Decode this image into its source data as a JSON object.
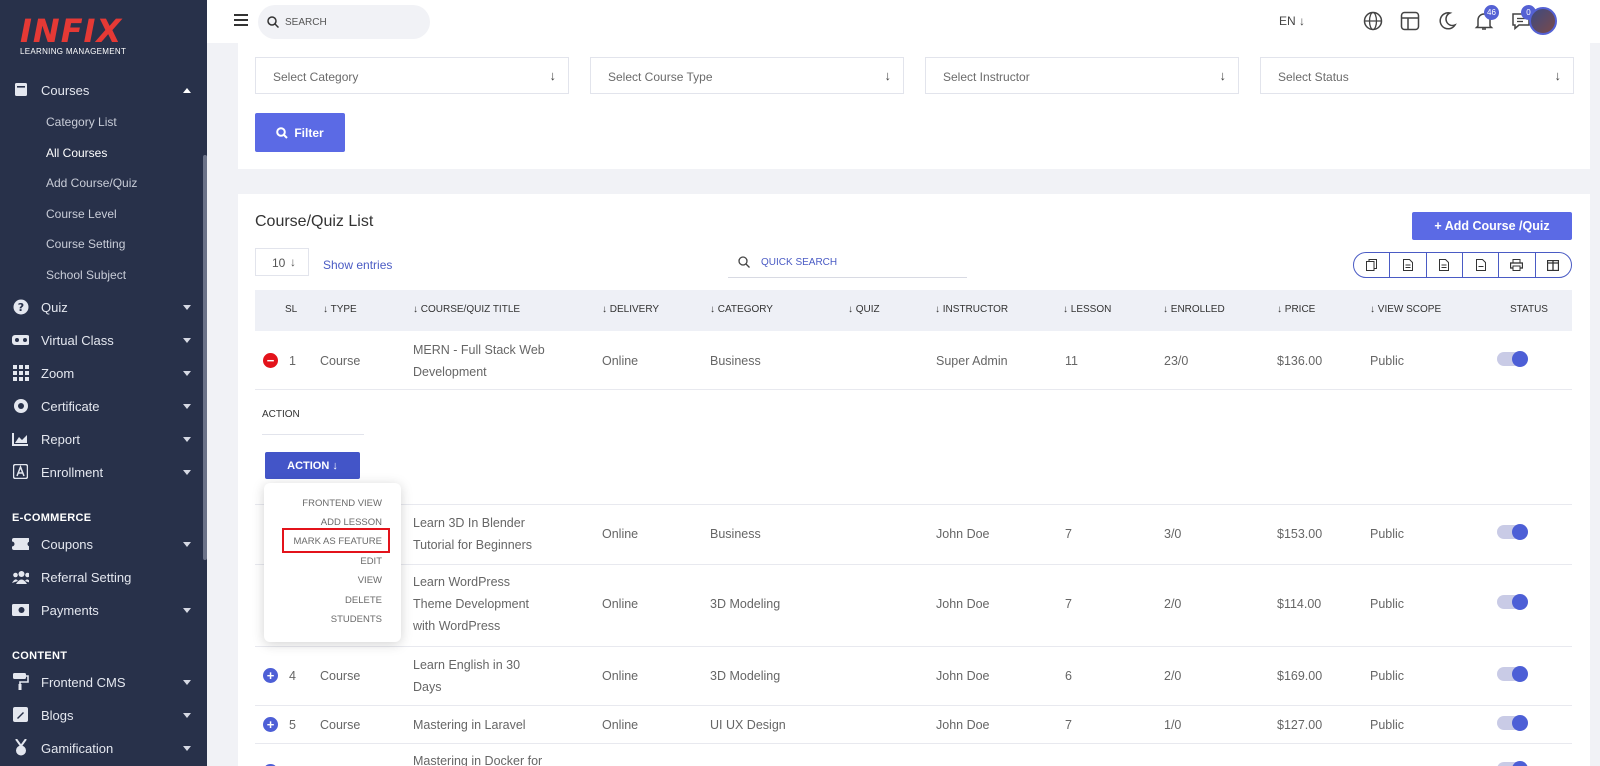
{
  "brand": {
    "logo": "INFIX",
    "tagline": "LEARNING MANAGEMENT"
  },
  "sidebar": {
    "courses": {
      "label": "Courses",
      "icon": "book-icon"
    },
    "sub_items": [
      "Category List",
      "All Courses",
      "Add Course/Quiz",
      "Course Level",
      "Course Setting",
      "School Subject"
    ],
    "items": [
      {
        "label": "Quiz",
        "icon": "question-icon"
      },
      {
        "label": "Virtual Class",
        "icon": "vr-icon"
      },
      {
        "label": "Zoom",
        "icon": "grid-icon"
      },
      {
        "label": "Certificate",
        "icon": "badge-icon"
      },
      {
        "label": "Report",
        "icon": "chart-icon"
      },
      {
        "label": "Enrollment",
        "icon": "enrollment-icon"
      }
    ],
    "section_ecommerce": "E-COMMERCE",
    "ecommerce_items": [
      {
        "label": "Coupons",
        "icon": "coupon-icon"
      },
      {
        "label": "Referral Setting",
        "icon": "users-icon"
      },
      {
        "label": "Payments",
        "icon": "money-icon"
      }
    ],
    "section_content": "CONTENT",
    "content_items": [
      {
        "label": "Frontend CMS",
        "icon": "paint-roller-icon"
      },
      {
        "label": "Blogs",
        "icon": "pen-icon"
      },
      {
        "label": "Gamification",
        "icon": "medal-icon"
      }
    ]
  },
  "topbar": {
    "search_placeholder": "SEARCH",
    "language": "EN ↓",
    "notifications": "46",
    "messages": "0"
  },
  "filters": {
    "category": "Select Category",
    "course_type": "Select Course Type",
    "instructor": "Select Instructor",
    "status": "Select Status",
    "filter_button": "Filter"
  },
  "list": {
    "title": "Course/Quiz List",
    "add_button": "+ Add Course /Quiz",
    "entries": "10",
    "show_entries": "Show entries",
    "quick_search": "QUICK SEARCH"
  },
  "table": {
    "headers": [
      "SL",
      "↓ TYPE",
      "↓ COURSE/QUIZ TITLE",
      "↓ DELIVERY",
      "↓ CATEGORY",
      "↓ QUIZ",
      "↓ INSTRUCTOR",
      "↓ LESSON",
      "↓ ENROLLED",
      "↓ PRICE",
      "↓ VIEW SCOPE",
      "STATUS"
    ],
    "rows": [
      {
        "sl": "1",
        "type": "Course",
        "title1": "MERN - Full Stack Web",
        "title2": "Development",
        "title3": "",
        "delivery": "Online",
        "category": "Business",
        "instructor": "Super Admin",
        "lesson": "11",
        "enrolled": "23/0",
        "price": "$136.00",
        "scope": "Public"
      },
      {
        "sl": "",
        "type": "",
        "title1": "Learn 3D In Blender",
        "title2": "Tutorial for Beginners",
        "title3": "",
        "delivery": "Online",
        "category": "Business",
        "instructor": "John Doe",
        "lesson": "7",
        "enrolled": "3/0",
        "price": "$153.00",
        "scope": "Public"
      },
      {
        "sl": "",
        "type": "",
        "title1": "Learn WordPress",
        "title2": "Theme Development",
        "title3": "with WordPress",
        "delivery": "Online",
        "category": "3D Modeling",
        "instructor": "John Doe",
        "lesson": "7",
        "enrolled": "2/0",
        "price": "$114.00",
        "scope": "Public"
      },
      {
        "sl": "4",
        "type": "Course",
        "title1": "Learn English in 30",
        "title2": "Days",
        "title3": "",
        "delivery": "Online",
        "category": "3D Modeling",
        "instructor": "John Doe",
        "lesson": "6",
        "enrolled": "2/0",
        "price": "$169.00",
        "scope": "Public"
      },
      {
        "sl": "5",
        "type": "Course",
        "title1": "Mastering in Laravel",
        "title2": "",
        "title3": "",
        "delivery": "Online",
        "category": "UI UX Design",
        "instructor": "John Doe",
        "lesson": "7",
        "enrolled": "1/0",
        "price": "$127.00",
        "scope": "Public"
      },
      {
        "sl": "",
        "type": "",
        "title1": "Mastering in Docker for",
        "title2": "",
        "title3": "",
        "delivery": "",
        "category": "",
        "instructor": "",
        "lesson": "",
        "enrolled": "",
        "price": "",
        "scope": ""
      }
    ]
  },
  "action": {
    "label": "ACTION",
    "button": "ACTION ↓",
    "menu": [
      "FRONTEND VIEW",
      "ADD LESSON",
      "MARK AS FEATURE",
      "EDIT",
      "VIEW",
      "DELETE",
      "STUDENTS"
    ]
  },
  "colors": {
    "primary": "#5b6ae5",
    "sidebar": "#28314a",
    "highlight": "#e3131b",
    "minus": "#e3131b",
    "plus": "#4d5fd6"
  }
}
